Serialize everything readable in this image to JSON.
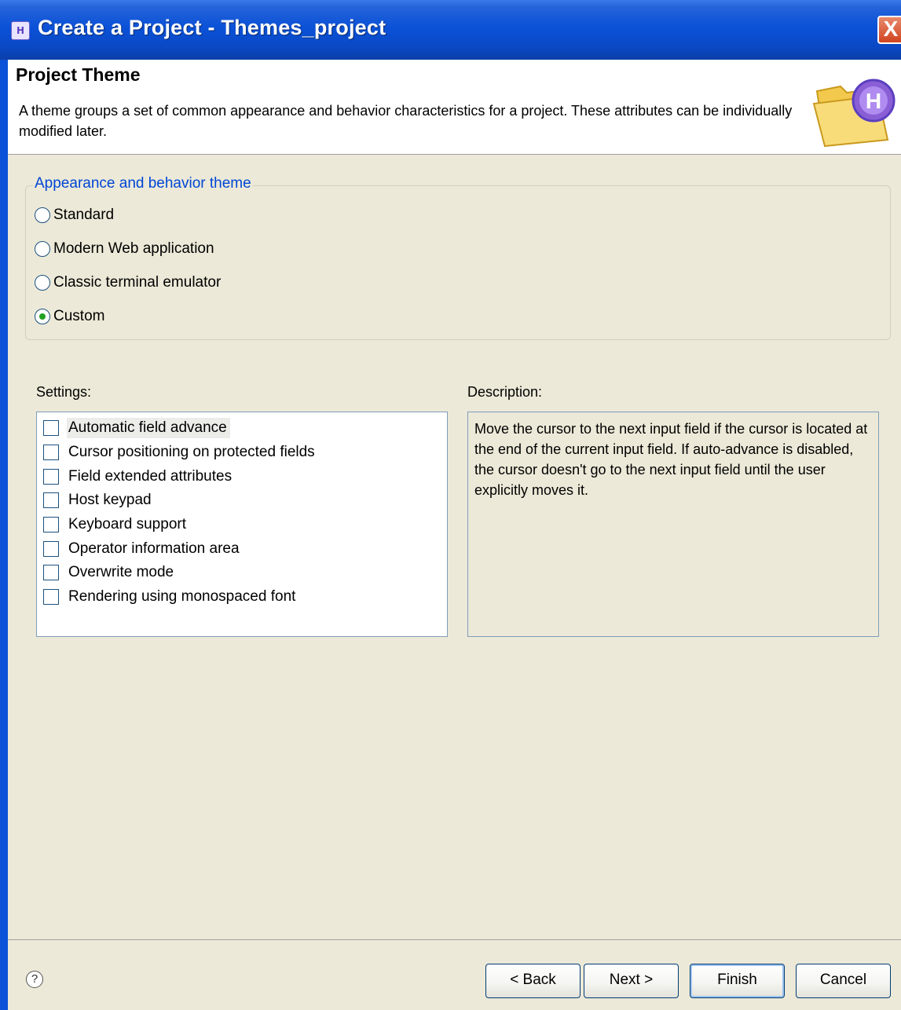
{
  "window": {
    "title": "Create a Project - Themes_project",
    "app_icon": "project-wizard-icon",
    "close_label": "X"
  },
  "header": {
    "title": "Project Theme",
    "description": "A theme groups a set of common appearance and behavior characteristics for a project. These attributes can be individually modified later.",
    "logo": "folder-h-icon",
    "logo_letter": "H"
  },
  "theme_group": {
    "legend": "Appearance and behavior theme",
    "options": [
      {
        "label": "Standard",
        "checked": false
      },
      {
        "label": "Modern Web application",
        "checked": false
      },
      {
        "label": "Classic terminal emulator",
        "checked": false
      },
      {
        "label": "Custom",
        "checked": true
      }
    ]
  },
  "settings": {
    "label": "Settings:",
    "items": [
      {
        "label": "Automatic field advance",
        "checked": false,
        "selected": true
      },
      {
        "label": "Cursor positioning on protected fields",
        "checked": false,
        "selected": false
      },
      {
        "label": "Field extended attributes",
        "checked": false,
        "selected": false
      },
      {
        "label": "Host keypad",
        "checked": false,
        "selected": false
      },
      {
        "label": "Keyboard support",
        "checked": false,
        "selected": false
      },
      {
        "label": "Operator information area",
        "checked": false,
        "selected": false
      },
      {
        "label": "Overwrite mode",
        "checked": false,
        "selected": false
      },
      {
        "label": "Rendering using monospaced font",
        "checked": false,
        "selected": false
      }
    ]
  },
  "description": {
    "label": "Description:",
    "text": "Move the cursor to the next input field if the cursor is located at the end of the current input field. If auto-advance is disabled, the cursor doesn't go to the next input field until the user explicitly moves it."
  },
  "footer": {
    "help_icon": "help-icon",
    "help_glyph": "?",
    "back_label": "< Back",
    "next_label": "Next >",
    "finish_label": "Finish",
    "cancel_label": "Cancel"
  },
  "colors": {
    "title_bar": "#0b52d8",
    "legend": "#0046d5",
    "window_bg": "#ece9d8"
  }
}
